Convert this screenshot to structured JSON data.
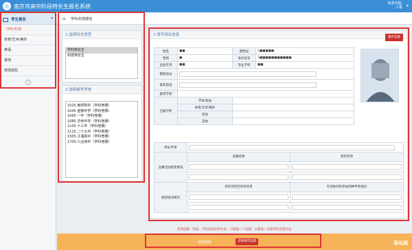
{
  "header": {
    "title": "南京市高中阶段特长生报名系统",
    "user_line1": "欢迎光临,",
    "user_line2": "卜家"
  },
  "sidebar": {
    "head": "考生报名",
    "items": [
      {
        "label": "学科/科技"
      },
      {
        "label": "体育/艺术/两外"
      },
      {
        "label": "英语"
      },
      {
        "label": "其他"
      },
      {
        "label": "修改密码"
      }
    ]
  },
  "breadcrumb": "学科/科技报名",
  "panel1": {
    "title": "1.选择特长类型",
    "options": [
      "学科特长生",
      "科技特长生"
    ]
  },
  "panel2": {
    "title": "2.选择报考学校",
    "options": [
      "1025.南师附中（学科竞赛）",
      "1045.金陵中学（学科竞赛）",
      "1065.一中（学科竞赛）",
      "1085.华侨中学（学科竞赛）",
      "1105.十三中（学科竞赛）",
      "1115.二十九中（学科竞赛）",
      "1505.江浦高中（学科竞赛）",
      "1705.六合高中（学科竞赛）"
    ]
  },
  "panel3": {
    "title": "3.填写相关信息",
    "save_btn": "暂存志愿",
    "labels": {
      "name": "姓名",
      "reg_no": "建档号",
      "gender": "性别",
      "id_no": "身份证号",
      "birth": "出生年月",
      "school": "毕业学校",
      "address": "家庭住址",
      "phone": "联系电话",
      "apply_school": "报考学校",
      "registered": "已报学校",
      "subj": "学科/科技",
      "sport": "体育/艺术/两外",
      "english": "英语",
      "other": "其他",
      "specialty": "特长专项",
      "competition": "竞赛活动获奖情况",
      "comp_name": "竞赛名称",
      "award": "获奖奖项",
      "training": "接受培训简历",
      "date": "何年何月至何年何月",
      "train_place": "在何地何校参加何种专项培训"
    },
    "values": {
      "name": "■■",
      "reg_no": "1■■■■■",
      "gender": "■",
      "id_no": "3■■■■■■■■■■■",
      "birth": "■■",
      "school": "■■"
    }
  },
  "notice": "友情提醒：科技、学科类型的特长生，只能报一个志愿，以最后一次保存的志愿为准",
  "bottom": {
    "text": "保存志愿",
    "btn": "点我保存志愿"
  },
  "watermark": "深长网"
}
